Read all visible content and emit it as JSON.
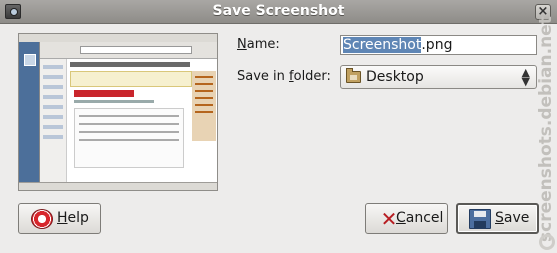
{
  "window": {
    "title": "Save Screenshot"
  },
  "form": {
    "name_label": "Name:",
    "name_value_selected": "Screenshot",
    "name_value_rest": ".png",
    "folder_label": "Save in folder:",
    "folder_value": "Desktop"
  },
  "buttons": {
    "help": "Help",
    "cancel": "Cancel",
    "save": "Save"
  },
  "watermark": {
    "text": "screenshots.debian.net"
  },
  "icons": {
    "window": "screenshot-app-icon",
    "close": "close-icon",
    "folder": "folder-icon",
    "combo": "up-down-arrows-icon",
    "help": "lifebuoy-icon",
    "cancel": "x-cancel-icon",
    "save": "floppy-disk-icon"
  },
  "colors": {
    "selection": "#5f86b5",
    "titlebar": "#9b9995"
  }
}
